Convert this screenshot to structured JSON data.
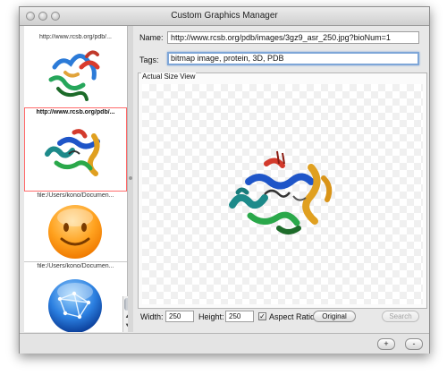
{
  "window": {
    "title": "Custom Graphics Manager"
  },
  "list": {
    "items": [
      {
        "label": "http://www.rcsb.org/pdb/...",
        "thumbnail": "protein-structure-image"
      },
      {
        "label": "http://www.rcsb.org/pdb/...",
        "thumbnail": "protein-structure-image",
        "selected": true
      },
      {
        "label": "file:/Users/kono/Documen...",
        "thumbnail": "smiley-face-image"
      },
      {
        "label": "file:/Users/kono/Documen...",
        "thumbnail": "globe-network-image"
      }
    ]
  },
  "form": {
    "name_label": "Name:",
    "name_value": "http://www.rcsb.org/pdb/images/3gz9_asr_250.jpg?bioNum=1",
    "tags_label": "Tags:",
    "tags_value": "bitmap image, protein, 3D, PDB"
  },
  "preview": {
    "title": "Actual Size View",
    "image": "protein-structure-image"
  },
  "controls": {
    "width_label": "Width:",
    "width_value": "250",
    "height_label": "Height:",
    "height_value": "250",
    "aspect_ratio_label": "Aspect Ratio",
    "aspect_ratio_checked": true,
    "original_button": "Original",
    "search_button": "Search"
  },
  "footer": {
    "add_button": "+",
    "remove_button": "-"
  },
  "colors": {
    "selection_outline": "#ff6a6a",
    "focus_ring": "#7ea6d8"
  }
}
